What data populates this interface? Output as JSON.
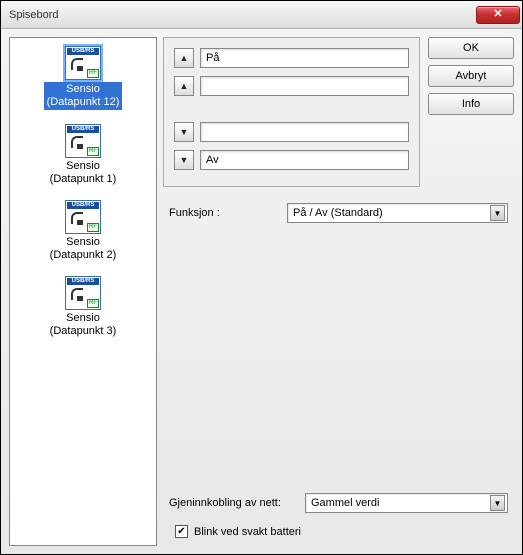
{
  "window": {
    "title": "Spisebord"
  },
  "buttons": {
    "ok": "OK",
    "cancel": "Avbryt",
    "info": "Info"
  },
  "devices": [
    {
      "label": "Sensio\n(Datapunkt 12)",
      "selected": true
    },
    {
      "label": "Sensio\n(Datapunkt 1)",
      "selected": false
    },
    {
      "label": "Sensio\n(Datapunkt 2)",
      "selected": false
    },
    {
      "label": "Sensio\n(Datapunkt 3)",
      "selected": false
    }
  ],
  "device_icon": {
    "top_text": "USB/RS",
    "rf_text": "RF"
  },
  "config_rows": {
    "row1": {
      "value": "På"
    },
    "row2": {
      "value": ""
    },
    "row3": {
      "value": ""
    },
    "row4": {
      "value": "Av"
    }
  },
  "function": {
    "label": "Funksjon :",
    "value": "På / Av (Standard)"
  },
  "reconnect": {
    "label": "Gjeninnkobling av nett:",
    "value": "Gammel verdi"
  },
  "blink": {
    "label": "Blink ved svakt batteri",
    "checked": true
  }
}
